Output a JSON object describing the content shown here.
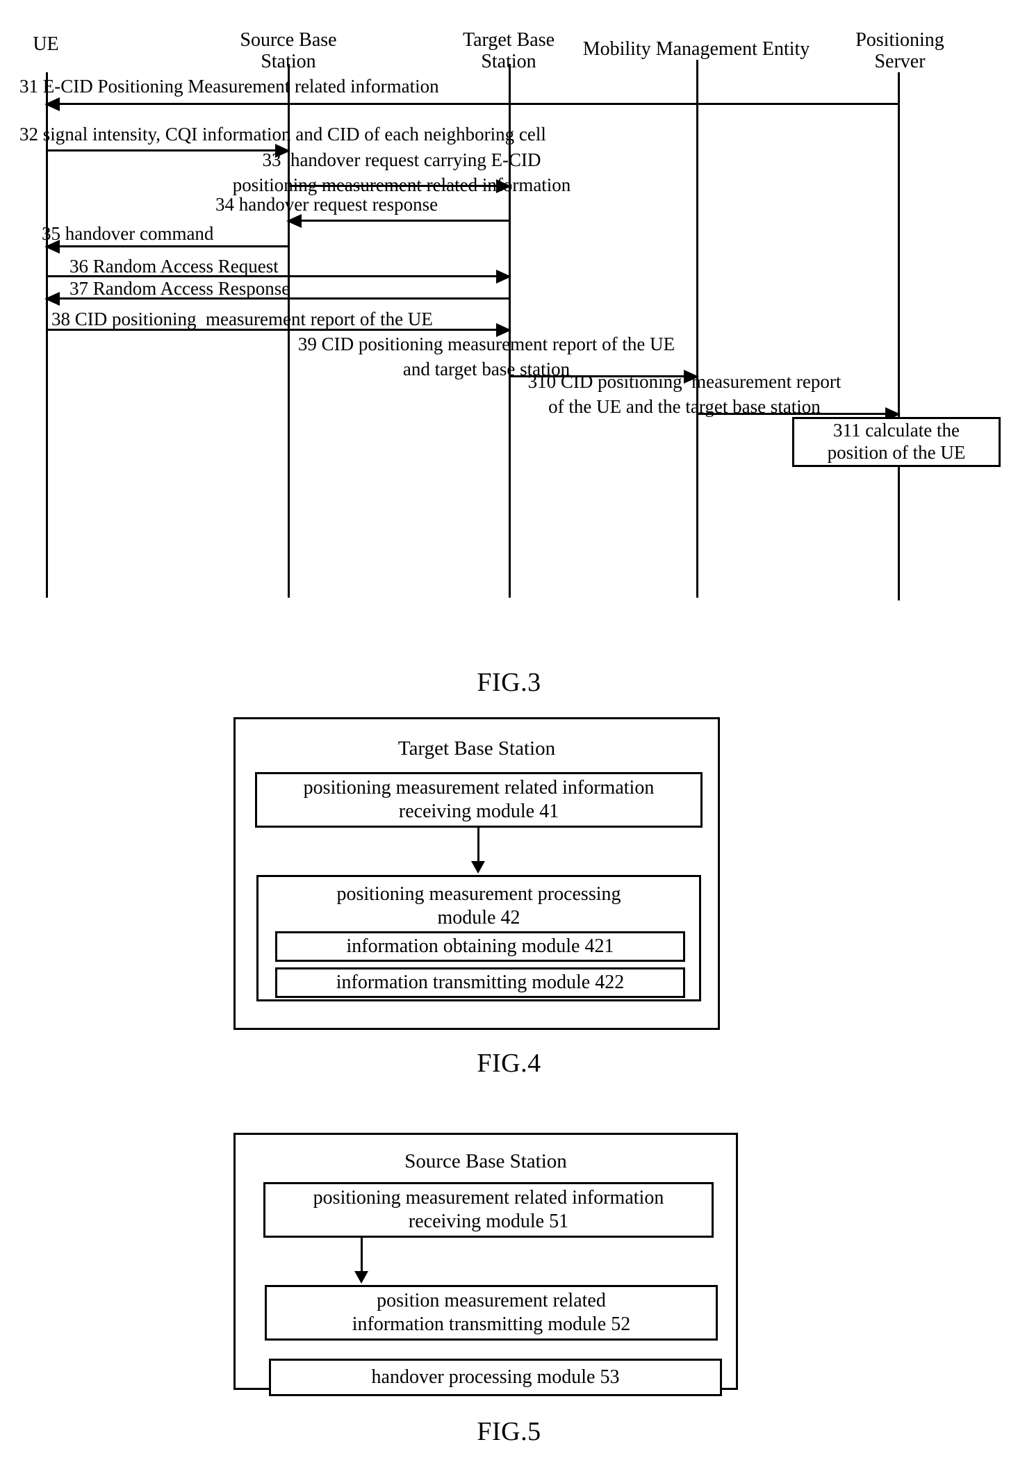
{
  "figures": [
    {
      "id": "fig3",
      "caption": "FIG.3",
      "type": "sequence-diagram",
      "actors": [
        {
          "id": "ue",
          "label": "UE"
        },
        {
          "id": "source-base-station",
          "label": "Source Base\nStation"
        },
        {
          "id": "target-base-station",
          "label": "Target Base\nStation"
        },
        {
          "id": "mobility-management-entity",
          "label": "Mobility Management Entity"
        },
        {
          "id": "positioning-server",
          "label": "Positioning\nServer"
        }
      ],
      "messages": [
        {
          "number": "31",
          "text": "31 E-CID Positioning Measurement related information",
          "from": "positioning-server",
          "to": "ue",
          "direction": "left"
        },
        {
          "number": "32",
          "text": "32 signal intensity, CQI information and CID of each neighboring cell",
          "from": "ue",
          "to": "source-base-station",
          "direction": "right"
        },
        {
          "number": "33",
          "text": "33  handover request carrying E-CID\npositioning measurement related information",
          "from": "source-base-station",
          "to": "target-base-station",
          "direction": "right"
        },
        {
          "number": "34",
          "text": "34 handover request response",
          "from": "target-base-station",
          "to": "source-base-station",
          "direction": "left"
        },
        {
          "number": "35",
          "text": "35 handover command",
          "from": "source-base-station",
          "to": "ue",
          "direction": "left"
        },
        {
          "number": "36",
          "text": "36 Random Access Request",
          "from": "ue",
          "to": "target-base-station",
          "direction": "right"
        },
        {
          "number": "37",
          "text": "37 Random Access Response",
          "from": "target-base-station",
          "to": "ue",
          "direction": "left"
        },
        {
          "number": "38",
          "text": "38 CID positioning  measurement report of the UE",
          "from": "ue",
          "to": "target-base-station",
          "direction": "right"
        },
        {
          "number": "39",
          "text": "39 CID positioning measurement report of the UE\nand target base station",
          "from": "target-base-station",
          "to": "mobility-management-entity",
          "direction": "right"
        },
        {
          "number": "310",
          "text": "310 CID positioning  measurement report\nof the UE and the target base station",
          "from": "mobility-management-entity",
          "to": "positioning-server",
          "direction": "right"
        }
      ],
      "note": {
        "number": "311",
        "text": "311 calculate the\nposition of the UE"
      }
    },
    {
      "id": "fig4",
      "caption": "FIG.4",
      "type": "block-diagram",
      "title": "Target Base Station",
      "blocks": [
        {
          "id": "module-41",
          "text": "positioning measurement related information\nreceiving module 41"
        },
        {
          "id": "module-42",
          "text": "positioning measurement processing\nmodule 42"
        },
        {
          "id": "module-421",
          "text": "information obtaining module 421"
        },
        {
          "id": "module-422",
          "text": "information transmitting module   422"
        }
      ]
    },
    {
      "id": "fig5",
      "caption": "FIG.5",
      "type": "block-diagram",
      "title": "Source Base Station",
      "blocks": [
        {
          "id": "module-51",
          "text": "positioning measurement related information\nreceiving module 51"
        },
        {
          "id": "module-52",
          "text": "position measurement related\ninformation transmitting module 52"
        },
        {
          "id": "module-53",
          "text": "handover processing module 53"
        }
      ]
    }
  ]
}
